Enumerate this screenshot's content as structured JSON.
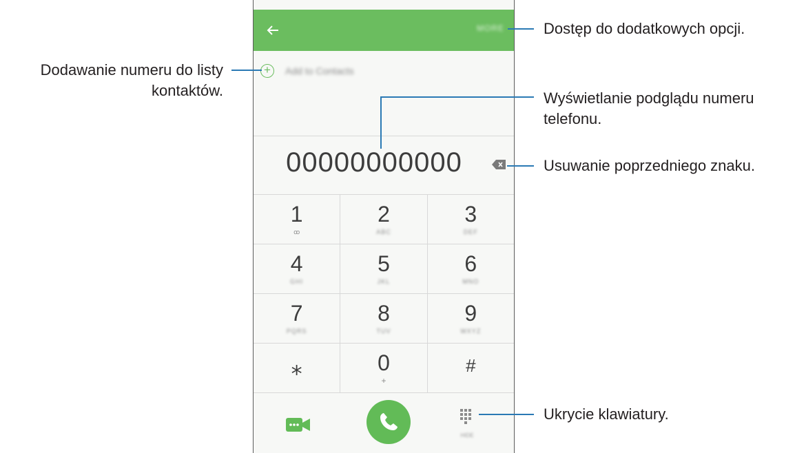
{
  "phone": {
    "appbar": {
      "more_label": "MORE",
      "back_icon": "arrow-left-icon"
    },
    "add_to_contacts": {
      "label": "Add to Contacts",
      "icon": "plus-circle-icon"
    },
    "number": "00000000000",
    "keypad": [
      [
        {
          "digit": "1",
          "sub": "ꝏ"
        },
        {
          "digit": "2",
          "sub": "ABC"
        },
        {
          "digit": "3",
          "sub": "DEF"
        }
      ],
      [
        {
          "digit": "4",
          "sub": "GHI"
        },
        {
          "digit": "5",
          "sub": "JKL"
        },
        {
          "digit": "6",
          "sub": "MNO"
        }
      ],
      [
        {
          "digit": "7",
          "sub": "PQRS"
        },
        {
          "digit": "8",
          "sub": "TUV"
        },
        {
          "digit": "9",
          "sub": "WXYZ"
        }
      ],
      [
        {
          "digit": "⁎",
          "sub": ""
        },
        {
          "digit": "0",
          "sub": "+"
        },
        {
          "digit": "#",
          "sub": ""
        }
      ]
    ],
    "hide_keypad_sub": "HIDE",
    "colors": {
      "accent": "#6bbd5f",
      "call": "#62bb57",
      "leader": "#2a79b4"
    }
  },
  "annotations": {
    "more": "Dostęp do dodatkowych opcji.",
    "add_line1": "Dodawanie numeru do listy",
    "add_line2": "kontaktów.",
    "preview_line1": "Wyświetlanie podglądu numeru",
    "preview_line2": "telefonu.",
    "delete": "Usuwanie poprzedniego znaku.",
    "hide": "Ukrycie klawiatury."
  }
}
